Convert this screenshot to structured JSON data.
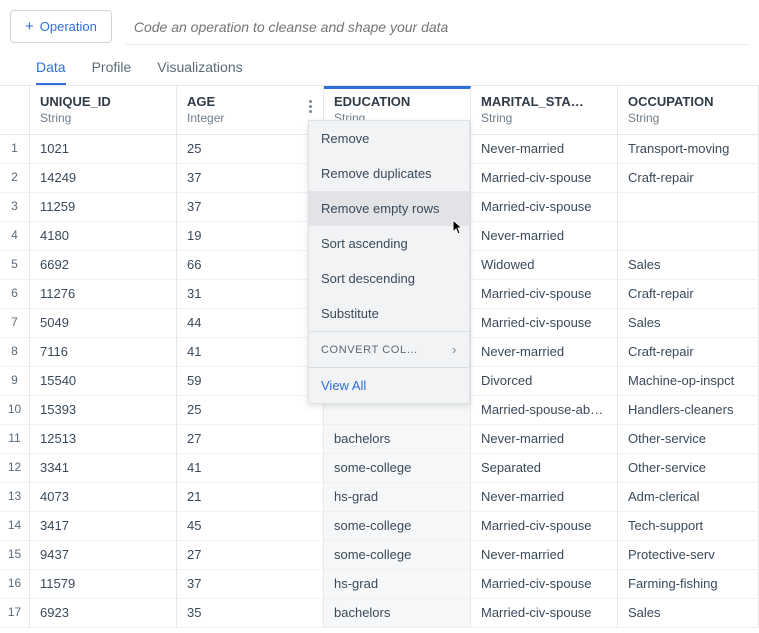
{
  "toolbar": {
    "operation_label": "Operation",
    "code_placeholder": "Code an operation to cleanse and shape your data"
  },
  "tabs": [
    {
      "label": "Data",
      "active": true
    },
    {
      "label": "Profile",
      "active": false
    },
    {
      "label": "Visualizations",
      "active": false
    }
  ],
  "columns": [
    {
      "name": "UNIQUE_ID",
      "type": "String",
      "highlighted": false
    },
    {
      "name": "AGE",
      "type": "Integer",
      "highlighted": false,
      "menuVisible": true
    },
    {
      "name": "EDUCATION",
      "type": "String",
      "highlighted": true
    },
    {
      "name": "MARITAL_STA…",
      "type": "String",
      "highlighted": false
    },
    {
      "name": "OCCUPATION",
      "type": "String",
      "highlighted": false
    }
  ],
  "rows": [
    {
      "n": "1",
      "unique_id": "1021",
      "age": "25",
      "education": "",
      "marital": "Never-married",
      "occupation": "Transport-moving"
    },
    {
      "n": "2",
      "unique_id": "14249",
      "age": "37",
      "education": "",
      "marital": "Married-civ-spouse",
      "occupation": "Craft-repair"
    },
    {
      "n": "3",
      "unique_id": "11259",
      "age": "37",
      "education": "",
      "marital": "Married-civ-spouse",
      "occupation": ""
    },
    {
      "n": "4",
      "unique_id": "4180",
      "age": "19",
      "education": "",
      "marital": "Never-married",
      "occupation": ""
    },
    {
      "n": "5",
      "unique_id": "6692",
      "age": "66",
      "education": "",
      "marital": "Widowed",
      "occupation": "Sales"
    },
    {
      "n": "6",
      "unique_id": "11276",
      "age": "31",
      "education": "",
      "marital": "Married-civ-spouse",
      "occupation": "Craft-repair"
    },
    {
      "n": "7",
      "unique_id": "5049",
      "age": "44",
      "education": "",
      "marital": "Married-civ-spouse",
      "occupation": "Sales"
    },
    {
      "n": "8",
      "unique_id": "7116",
      "age": "41",
      "education": "",
      "marital": "Never-married",
      "occupation": "Craft-repair"
    },
    {
      "n": "9",
      "unique_id": "15540",
      "age": "59",
      "education": "",
      "marital": "Divorced",
      "occupation": "Machine-op-inspct"
    },
    {
      "n": "10",
      "unique_id": "15393",
      "age": "25",
      "education": "",
      "marital": "Married-spouse-ab…",
      "occupation": "Handlers-cleaners"
    },
    {
      "n": "11",
      "unique_id": "12513",
      "age": "27",
      "education": "bachelors",
      "marital": "Never-married",
      "occupation": "Other-service"
    },
    {
      "n": "12",
      "unique_id": "3341",
      "age": "41",
      "education": "some-college",
      "marital": "Separated",
      "occupation": "Other-service"
    },
    {
      "n": "13",
      "unique_id": "4073",
      "age": "21",
      "education": "hs-grad",
      "marital": "Never-married",
      "occupation": "Adm-clerical"
    },
    {
      "n": "14",
      "unique_id": "3417",
      "age": "45",
      "education": "some-college",
      "marital": "Married-civ-spouse",
      "occupation": "Tech-support"
    },
    {
      "n": "15",
      "unique_id": "9437",
      "age": "27",
      "education": "some-college",
      "marital": "Never-married",
      "occupation": "Protective-serv"
    },
    {
      "n": "16",
      "unique_id": "11579",
      "age": "37",
      "education": "hs-grad",
      "marital": "Married-civ-spouse",
      "occupation": "Farming-fishing"
    },
    {
      "n": "17",
      "unique_id": "6923",
      "age": "35",
      "education": "bachelors",
      "marital": "Married-civ-spouse",
      "occupation": "Sales"
    }
  ],
  "context_menu": {
    "items": [
      {
        "label": "Remove",
        "hover": false
      },
      {
        "label": "Remove duplicates",
        "hover": false
      },
      {
        "label": "Remove empty rows",
        "hover": true
      },
      {
        "label": "Sort ascending",
        "hover": false
      },
      {
        "label": "Sort descending",
        "hover": false
      },
      {
        "label": "Substitute",
        "hover": false
      }
    ],
    "submenu_label": "CONVERT COL…",
    "view_all_label": "View All"
  }
}
